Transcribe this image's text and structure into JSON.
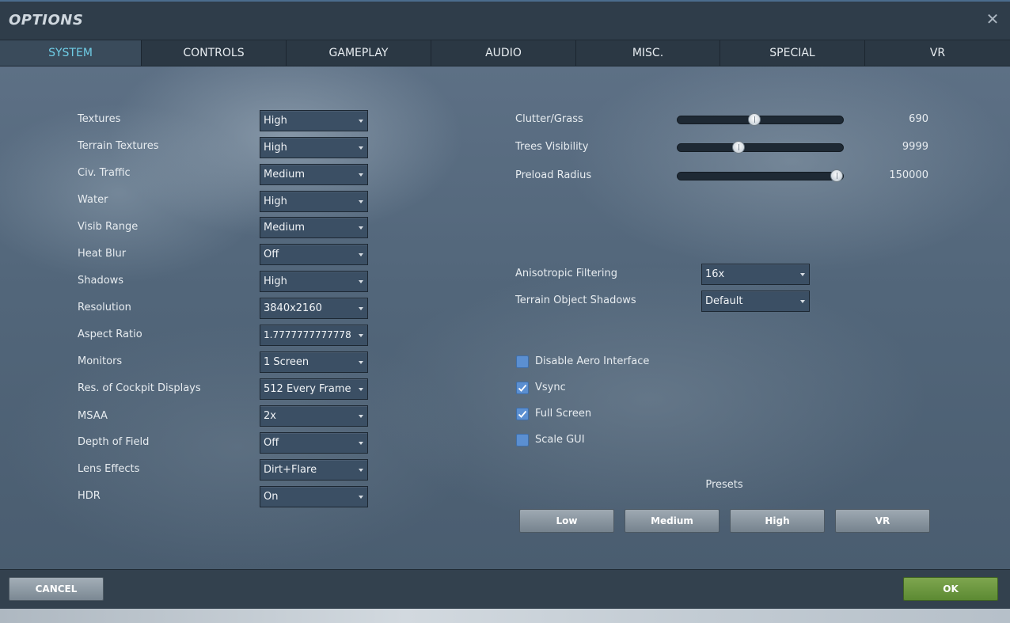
{
  "window": {
    "title": "OPTIONS",
    "close_glyph": "✕"
  },
  "tabs": [
    {
      "label": "SYSTEM",
      "active": true
    },
    {
      "label": "CONTROLS"
    },
    {
      "label": "GAMEPLAY"
    },
    {
      "label": "AUDIO"
    },
    {
      "label": "MISC."
    },
    {
      "label": "SPECIAL"
    },
    {
      "label": "VR"
    }
  ],
  "left_settings": [
    {
      "label": "Textures",
      "value": "High"
    },
    {
      "label": "Terrain Textures",
      "value": "High"
    },
    {
      "label": "Civ. Traffic",
      "value": "Medium"
    },
    {
      "label": "Water",
      "value": "High"
    },
    {
      "label": "Visib Range",
      "value": "Medium"
    },
    {
      "label": "Heat Blur",
      "value": "Off"
    },
    {
      "label": "Shadows",
      "value": "High"
    },
    {
      "label": "Resolution",
      "value": "3840x2160"
    },
    {
      "label": "Aspect Ratio",
      "value": "1.7777777777778"
    },
    {
      "label": "Monitors",
      "value": "1 Screen"
    },
    {
      "label": "Res. of Cockpit Displays",
      "value": "512 Every Frame"
    },
    {
      "label": "MSAA",
      "value": "2x"
    },
    {
      "label": "Depth of Field",
      "value": "Off"
    },
    {
      "label": "Lens Effects",
      "value": "Dirt+Flare"
    },
    {
      "label": "HDR",
      "value": "On"
    }
  ],
  "sliders": [
    {
      "label": "Clutter/Grass",
      "value": "690",
      "level": 0.46
    },
    {
      "label": "Trees Visibility",
      "value": "9999",
      "level": 0.36
    },
    {
      "label": "Preload Radius",
      "value": "150000",
      "level": 1.0
    }
  ],
  "right_selects": [
    {
      "label": "Anisotropic Filtering",
      "value": "16x"
    },
    {
      "label": "Terrain Object Shadows",
      "value": "Default"
    }
  ],
  "checkboxes": [
    {
      "label": "Disable Aero Interface",
      "checked": false
    },
    {
      "label": "Vsync",
      "checked": true
    },
    {
      "label": "Full Screen",
      "checked": true
    },
    {
      "label": "Scale GUI",
      "checked": false
    }
  ],
  "presets": {
    "title": "Presets",
    "buttons": [
      "Low",
      "Medium",
      "High",
      "VR"
    ]
  },
  "footer": {
    "cancel_label": "CANCEL",
    "ok_label": "OK"
  },
  "colors": {
    "active_tab_text": "#6fcde6",
    "checkbox": "#5b8fd1",
    "ok_button": "#6b983f"
  },
  "icons": {
    "close": "close-icon",
    "dropdown": "chevron-down-icon",
    "check": "checkmark-icon"
  }
}
